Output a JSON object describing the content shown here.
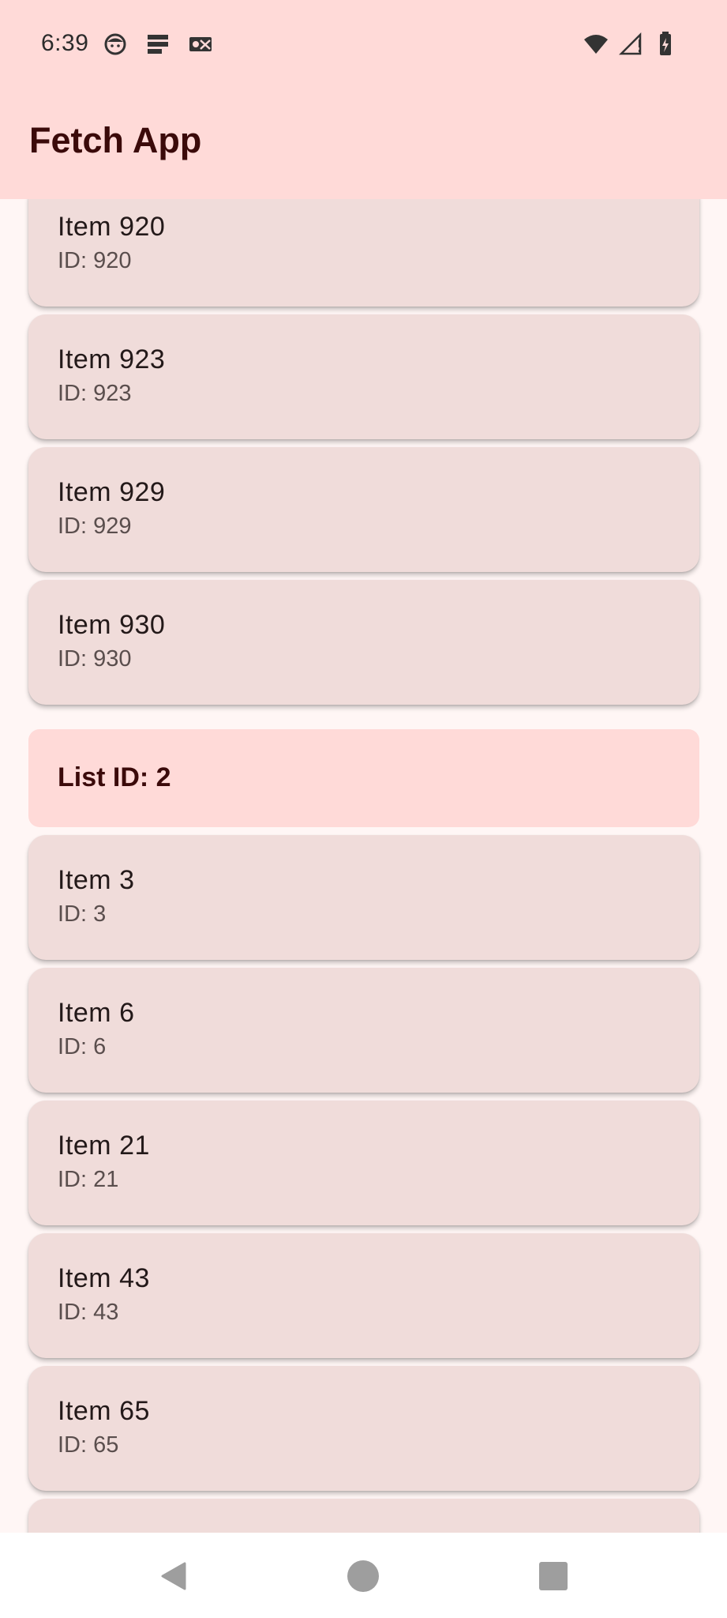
{
  "status_bar": {
    "time": "6:39",
    "left_icons": [
      "face-icon",
      "notes-icon",
      "photo-badge-icon"
    ],
    "right_icons": [
      "wifi-icon",
      "signal-icon",
      "battery-charging-icon"
    ]
  },
  "app_bar": {
    "title": "Fetch App"
  },
  "list": {
    "items_group_1": [
      {
        "name": "Item 920",
        "id_text": "ID: 920"
      },
      {
        "name": "Item 923",
        "id_text": "ID: 923"
      },
      {
        "name": "Item 929",
        "id_text": "ID: 929"
      },
      {
        "name": "Item 930",
        "id_text": "ID: 930"
      }
    ],
    "group_header": "List ID: 2",
    "items_group_2": [
      {
        "name": "Item 3",
        "id_text": "ID: 3"
      },
      {
        "name": "Item 6",
        "id_text": "ID: 6"
      },
      {
        "name": "Item 21",
        "id_text": "ID: 21"
      },
      {
        "name": "Item 43",
        "id_text": "ID: 43"
      },
      {
        "name": "Item 65",
        "id_text": "ID: 65"
      }
    ]
  },
  "nav_bar": {
    "icons": [
      "back-icon",
      "home-icon",
      "recents-icon"
    ]
  },
  "colors": {
    "app_bar_bg": "#ffdad8",
    "card_bg": "#f0dcda",
    "page_bg": "#fff6f5",
    "title_color": "#3b0a0a"
  }
}
